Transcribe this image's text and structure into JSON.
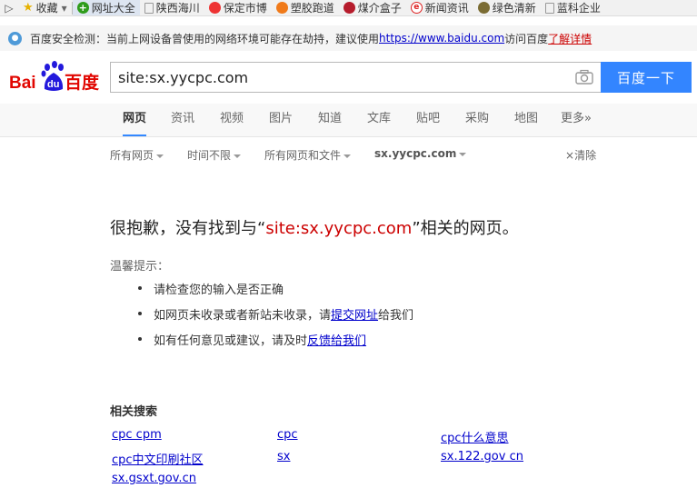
{
  "bookmarks": {
    "arrow": "▷",
    "favorites": "收藏",
    "favorites_caret": "▾",
    "items": [
      "网址大全",
      "陕西海川",
      "保定市博",
      "塑胶跑道",
      "煤介盒子",
      "新闻资讯",
      "绿色清新",
      "蓝科企业"
    ]
  },
  "notice": {
    "text": "百度安全检测：当前上网设备曾使用的网络环境可能存在劫持，建议使用",
    "link": "https://www.baidu.com",
    "after": "访问百度",
    "detail": "了解详情"
  },
  "logo": {
    "en_left": "Bai",
    "du": "du",
    "cn": "百度"
  },
  "search": {
    "query": "site:sx.yycpc.com",
    "button": "百度一下"
  },
  "tabs": [
    "网页",
    "资讯",
    "视频",
    "图片",
    "知道",
    "文库",
    "贴吧",
    "采购",
    "地图",
    "更多»"
  ],
  "filters": {
    "time_scope": "所有网页",
    "time": "时间不限",
    "file": "所有网页和文件",
    "site": "sx.yycpc.com",
    "clear": "清除",
    "clear_mark": "×"
  },
  "noresult": {
    "prefix": "很抱歉，没有找到与“",
    "query": "site:sx.yycpc.com",
    "suffix": "”相关的网页。"
  },
  "tips": {
    "title": "温馨提示：",
    "items": [
      {
        "text": "请检查您的输入是否正确"
      },
      {
        "before": "如网页未收录或者新站未收录，请",
        "link": "提交网址",
        "after": "给我们"
      },
      {
        "before": "如有任何意见或建议，请及时",
        "link": "反馈给我们"
      }
    ]
  },
  "related": {
    "title": "相关搜索",
    "items": [
      "cpc cpm",
      "cpc",
      "cpc什么意思",
      "cpc中文印刷社区",
      "sx",
      "sx.122.gov cn",
      "sx.gsxt.gov.cn"
    ]
  }
}
